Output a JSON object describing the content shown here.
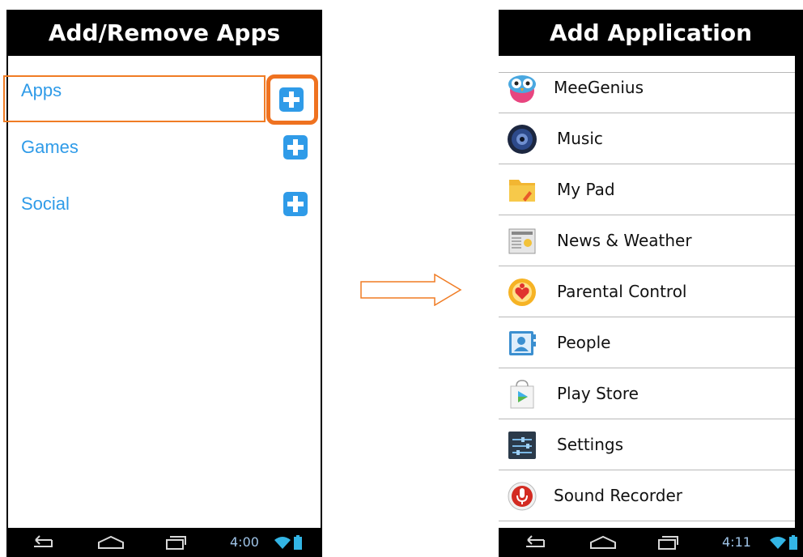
{
  "left_screen": {
    "title": "Add/Remove Apps",
    "categories": [
      {
        "label": "Apps",
        "icon": "plus-icon"
      },
      {
        "label": "Games",
        "icon": "plus-icon"
      },
      {
        "label": "Social",
        "icon": "plus-icon"
      }
    ],
    "time": "4:00"
  },
  "right_screen": {
    "title": "Add Application",
    "apps": [
      {
        "name": "MeeGenius",
        "icon": "owl-icon"
      },
      {
        "name": "Music",
        "icon": "speaker-icon"
      },
      {
        "name": "My Pad",
        "icon": "folder-icon"
      },
      {
        "name": "News & Weather",
        "icon": "newspaper-icon"
      },
      {
        "name": "Parental Control",
        "icon": "heart-badge-icon"
      },
      {
        "name": "People",
        "icon": "contact-card-icon"
      },
      {
        "name": "Play Store",
        "icon": "play-store-bag-icon"
      },
      {
        "name": "Settings",
        "icon": "sliders-icon"
      },
      {
        "name": "Sound Recorder",
        "icon": "microphone-icon"
      }
    ],
    "time": "4:11"
  },
  "colors": {
    "accent_blue": "#2f9be8",
    "highlight_orange": "#ef7220",
    "bar_black": "#000000",
    "status_blue": "#33b5e5"
  }
}
